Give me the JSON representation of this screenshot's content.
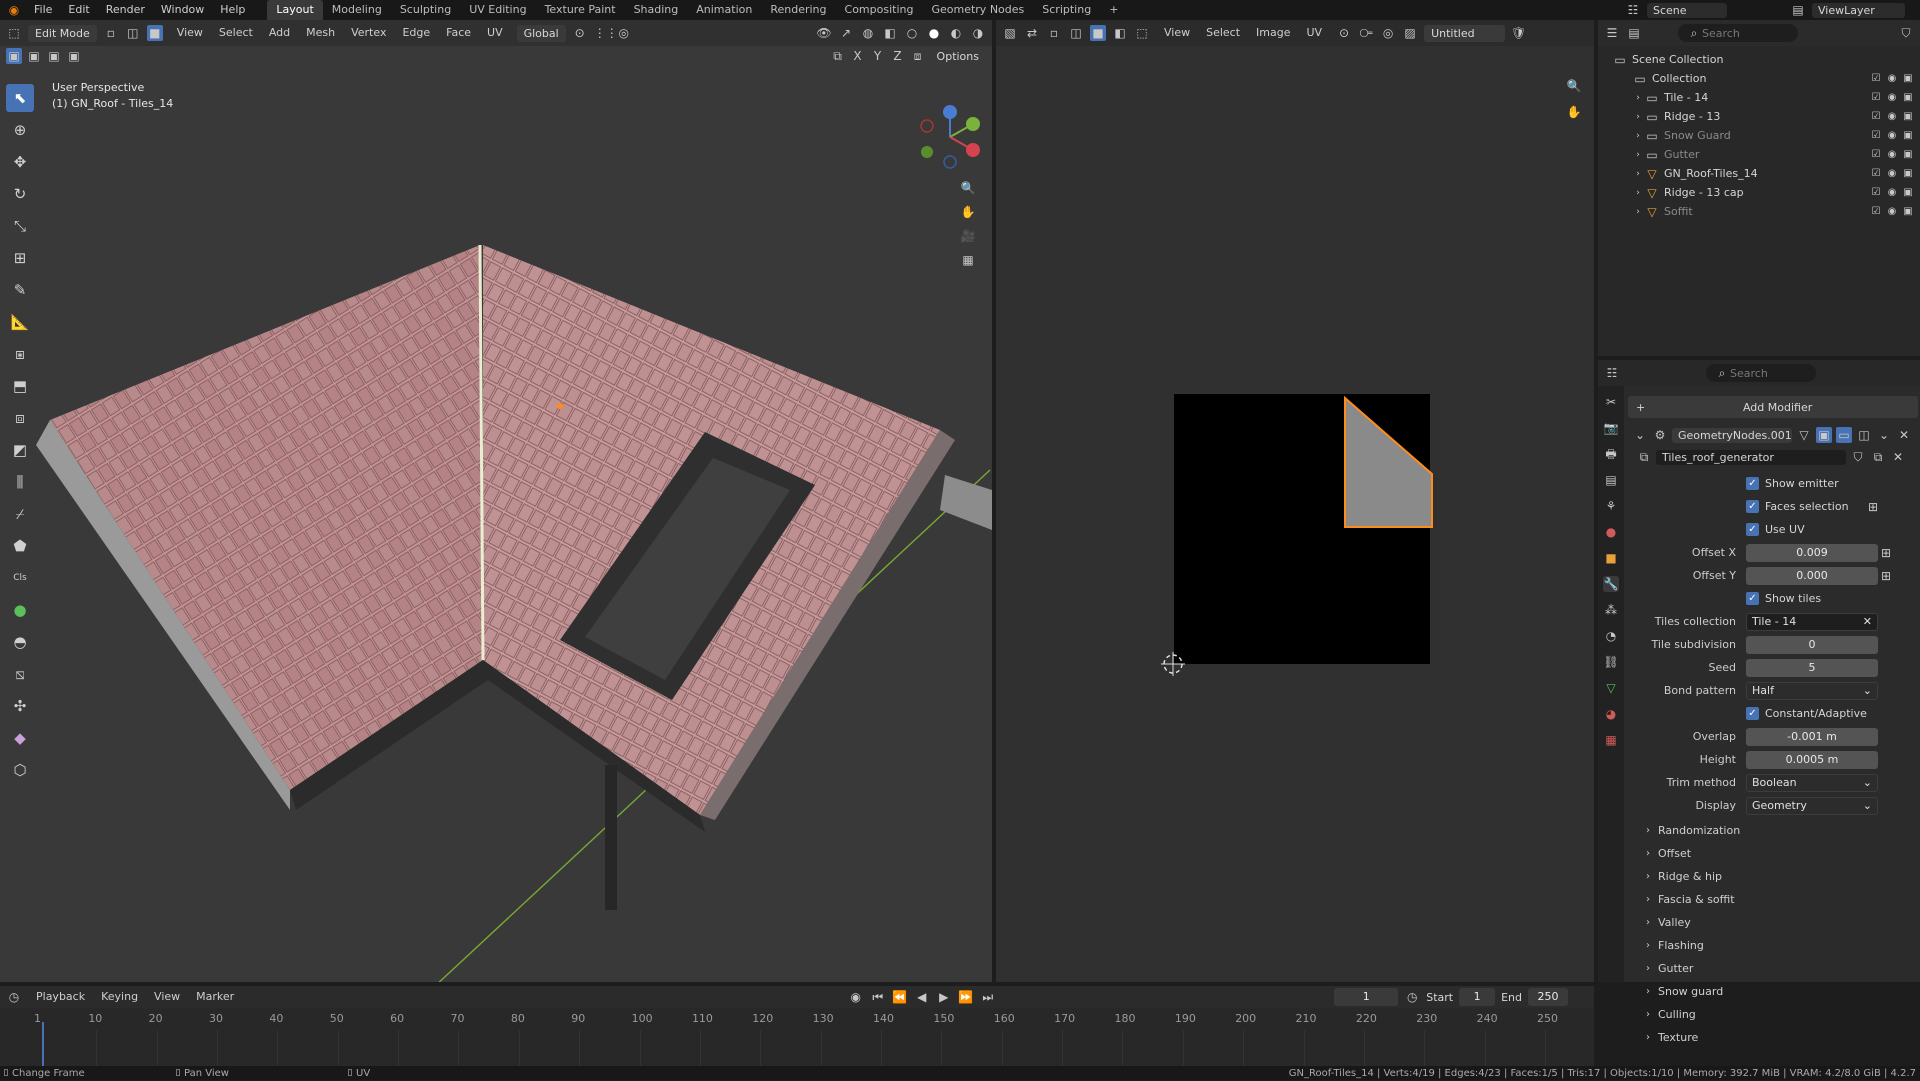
{
  "topbar": {
    "menus": [
      "File",
      "Edit",
      "Render",
      "Window",
      "Help"
    ],
    "workspaces": [
      "Layout",
      "Modeling",
      "Sculpting",
      "UV Editing",
      "Texture Paint",
      "Shading",
      "Animation",
      "Rendering",
      "Compositing",
      "Geometry Nodes",
      "Scripting"
    ],
    "add_tab": "+",
    "scene": "Scene",
    "view_layer": "ViewLayer"
  },
  "viewport": {
    "mode": "Edit Mode",
    "menus": [
      "View",
      "Select",
      "Add",
      "Mesh",
      "Vertex",
      "Edge",
      "Face",
      "UV"
    ],
    "transform": "Global",
    "options": "Options",
    "overlay_title": "User Perspective",
    "overlay_object": "(1) GN_Roof - Tiles_14",
    "axes": [
      "X",
      "Y",
      "Z"
    ]
  },
  "uv_editor": {
    "menus": [
      "View",
      "Select",
      "Image",
      "UV"
    ],
    "image_name": "Untitled"
  },
  "outliner": {
    "search_placeholder": "Search",
    "items": [
      {
        "name": "Scene Collection",
        "indent": 0
      },
      {
        "name": "Collection",
        "indent": 1
      },
      {
        "name": "Tile - 14",
        "indent": 1
      },
      {
        "name": "Ridge - 13",
        "indent": 1
      },
      {
        "name": "Snow Guard",
        "indent": 1,
        "dim": true
      },
      {
        "name": "Gutter",
        "indent": 1,
        "dim": true
      },
      {
        "name": "GN_Roof-Tiles_14",
        "indent": 1
      },
      {
        "name": "Ridge - 13 cap",
        "indent": 1
      },
      {
        "name": "Soffit",
        "indent": 1,
        "dim": true
      }
    ]
  },
  "properties": {
    "search_placeholder": "Search",
    "add_modifier": "Add Modifier",
    "modifier_name": "GeometryNodes.001",
    "node_group": "Tiles_roof_generator",
    "checks": {
      "show_emitter": "Show emitter",
      "faces_selection": "Faces selection",
      "use_uv": "Use UV",
      "show_tiles": "Show tiles",
      "constant_adaptive": "Constant/Adaptive"
    },
    "fields": {
      "offset_x_label": "Offset X",
      "offset_x": "0.009",
      "offset_y_label": "Offset Y",
      "offset_y": "0.000",
      "tiles_collection_label": "Tiles collection",
      "tiles_collection": "Tile - 14",
      "tile_subdivision_label": "Tile subdivision",
      "tile_subdivision": "0",
      "seed_label": "Seed",
      "seed": "5",
      "bond_pattern_label": "Bond pattern",
      "bond_pattern": "Half",
      "overlap_label": "Overlap",
      "overlap": "-0.001 m",
      "height_label": "Height",
      "height": "0.0005 m",
      "trim_method_label": "Trim method",
      "trim_method": "Boolean",
      "display_label": "Display",
      "display": "Geometry"
    },
    "sections": [
      "Randomization",
      "Offset",
      "Ridge & hip",
      "Fascia & soffit",
      "Valley",
      "Flashing",
      "Gutter",
      "Snow guard",
      "Culling",
      "Texture"
    ]
  },
  "timeline": {
    "menus": [
      "Playback",
      "Keying",
      "View",
      "Marker"
    ],
    "current_frame": "1",
    "start_label": "Start",
    "start": "1",
    "end_label": "End",
    "end": "250",
    "ticks": [
      "1",
      "10",
      "20",
      "30",
      "40",
      "50",
      "60",
      "70",
      "80",
      "90",
      "100",
      "110",
      "120",
      "130",
      "140",
      "150",
      "160",
      "170",
      "180",
      "190",
      "200",
      "210",
      "220",
      "230",
      "240",
      "250"
    ]
  },
  "statusbar": {
    "left": "Change Frame",
    "middle1": "Pan View",
    "middle2": "UV",
    "right": "GN_Roof-Tiles_14 | Verts:4/19 | Edges:4/23 | Faces:1/5 | Tris:17 | Objects:1/10 | Memory: 392.7 MiB | VRAM: 4.2/8.0 GiB | 4.2.7"
  },
  "colors": {
    "accent": "#4772b3",
    "tile": "#c79596",
    "uv_select": "#ff8c1a",
    "bg_panel": "#2b2b2b"
  }
}
